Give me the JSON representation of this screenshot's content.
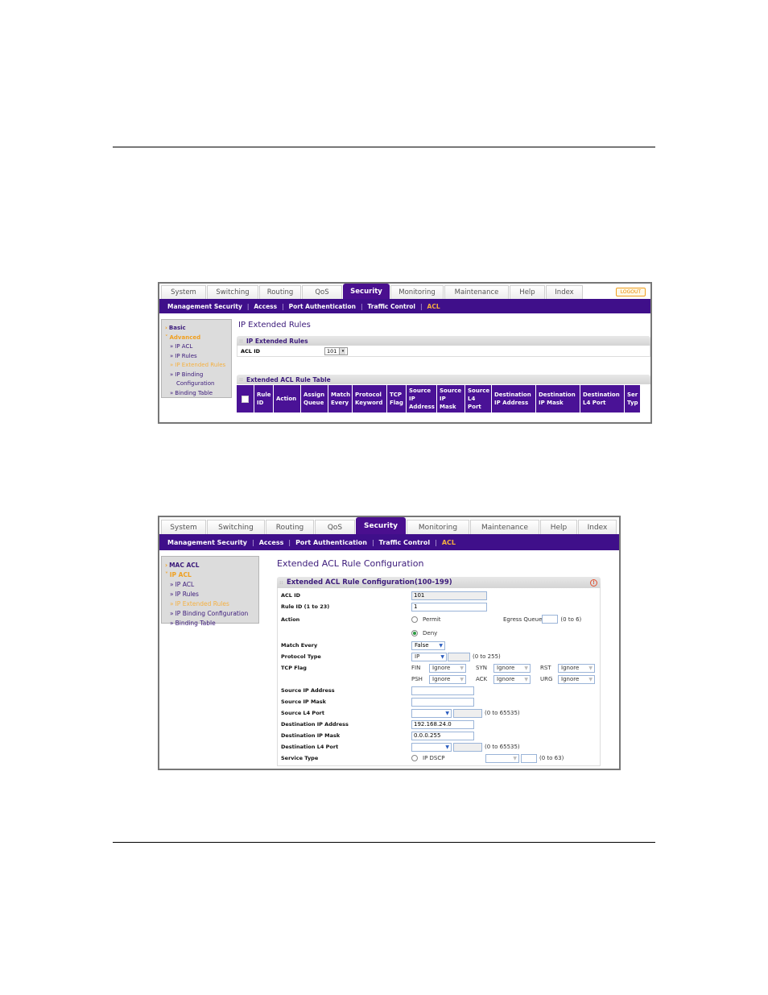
{
  "nav": {
    "tabs": [
      "System",
      "Switching",
      "Routing",
      "QoS",
      "Security",
      "Monitoring",
      "Maintenance",
      "Help",
      "Index"
    ],
    "active_tab": "Security",
    "logout": "LOGOUT",
    "subnav": [
      "Management Security",
      "Access",
      "Port Authentication",
      "Traffic Control",
      "ACL"
    ],
    "active_subnav": "ACL"
  },
  "screen1": {
    "sidebar": {
      "groups": [
        {
          "label": "Basic",
          "open": false
        },
        {
          "label": "Advanced",
          "open": true
        }
      ],
      "items": [
        "IP ACL",
        "IP Rules",
        "IP Extended Rules",
        "IP Binding",
        "Configuration",
        "Binding Table"
      ],
      "current": "IP Extended Rules"
    },
    "page_title": "IP Extended Rules",
    "panel_title": "IP Extended Rules",
    "acl_id_label": "ACL ID",
    "acl_id_value": "101",
    "table_title": "Extended ACL Rule Table",
    "columns": [
      "Rule\nID",
      "Action",
      "Assign\nQueue",
      "Match\nEvery",
      "Protocol\nKeyword",
      "TCP\nFlag",
      "Source\nIP\nAddress",
      "Source\nIP\nMask",
      "Source\nL4\nPort",
      "Destination\nIP Address",
      "Destination\nIP Mask",
      "Destination\nL4 Port",
      "Ser\nTyp"
    ]
  },
  "screen2": {
    "sidebar": {
      "groups": [
        {
          "label": "MAC ACL",
          "open": false
        },
        {
          "label": "IP ACL",
          "open": true
        }
      ],
      "items": [
        "IP ACL",
        "IP Rules",
        "IP Extended Rules",
        "IP Binding Configuration",
        "Binding Table"
      ],
      "current": "IP Extended Rules"
    },
    "page_title": "Extended ACL Rule Configuration",
    "panel_title": "Extended ACL Rule Configuration(100-199)",
    "fields": {
      "acl_id": {
        "label": "ACL ID",
        "value": "101"
      },
      "rule_id": {
        "label": "Rule ID (1 to 23)",
        "value": "1"
      },
      "action": {
        "label": "Action",
        "options": [
          "Permit",
          "Deny"
        ],
        "selected": "Deny",
        "egress_label": "Egress Queue",
        "egress_value": "",
        "egress_hint": "(0 to 6)"
      },
      "match_every": {
        "label": "Match Every",
        "value": "False"
      },
      "protocol_type": {
        "label": "Protocol Type",
        "value": "IP",
        "number": "",
        "hint": "(0 to 255)"
      },
      "tcp_flag": {
        "label": "TCP Flag",
        "flags": [
          {
            "name": "FIN",
            "value": "Ignore"
          },
          {
            "name": "SYN",
            "value": "Ignore"
          },
          {
            "name": "RST",
            "value": "Ignore"
          },
          {
            "name": "PSH",
            "value": "Ignore"
          },
          {
            "name": "ACK",
            "value": "Ignore"
          },
          {
            "name": "URG",
            "value": "Ignore"
          }
        ]
      },
      "src_ip": {
        "label": "Source IP Address",
        "value": ""
      },
      "src_mask": {
        "label": "Source IP Mask",
        "value": ""
      },
      "src_port": {
        "label": "Source L4 Port",
        "value": "",
        "number": "",
        "hint": "(0 to 65535)"
      },
      "dst_ip": {
        "label": "Destination IP Address",
        "value": "192.168.24.0"
      },
      "dst_mask": {
        "label": "Destination IP Mask",
        "value": "0.0.0.255"
      },
      "dst_port": {
        "label": "Destination L4 Port",
        "value": "",
        "number": "",
        "hint": "(0 to 65535)"
      },
      "service_type": {
        "label": "Service Type",
        "option": "IP DSCP",
        "hint": "(0 to 63)"
      }
    }
  }
}
